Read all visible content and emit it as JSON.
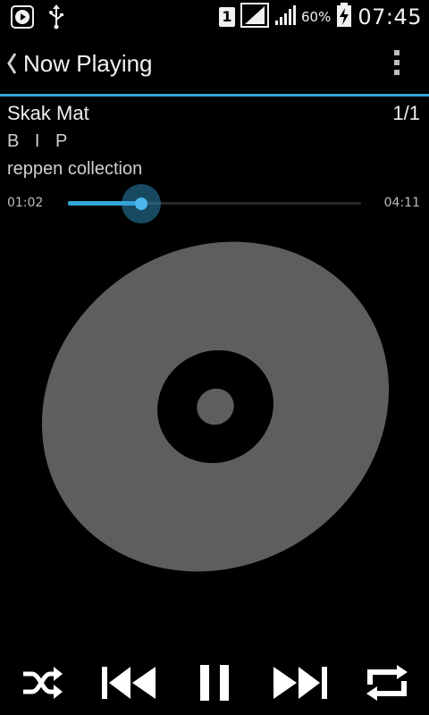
{
  "status_bar": {
    "sim_slot": "1",
    "battery_percent": "60%",
    "time": "07:45",
    "icons": [
      "play-store-icon",
      "usb-icon",
      "sim-icon",
      "signal-icon",
      "battery-charging-icon"
    ]
  },
  "action_bar": {
    "title": "Now Playing",
    "back_icon": "chevron-left-icon",
    "menu_icon": "overflow-menu-icon"
  },
  "track": {
    "title": "Skak Mat",
    "index": "1/1",
    "artist": "B I P",
    "album": "reppen collection"
  },
  "seek": {
    "elapsed": "01:02",
    "total": "04:11",
    "progress": 0.25
  },
  "album_art": {
    "icon": "disc-icon"
  },
  "controls": {
    "icons": [
      "shuffle-icon",
      "previous-icon",
      "pause-icon",
      "next-icon",
      "repeat-icon"
    ]
  },
  "colors": {
    "accent": "#33a3d8",
    "background": "#000000",
    "disc": "#5f5d5d"
  }
}
